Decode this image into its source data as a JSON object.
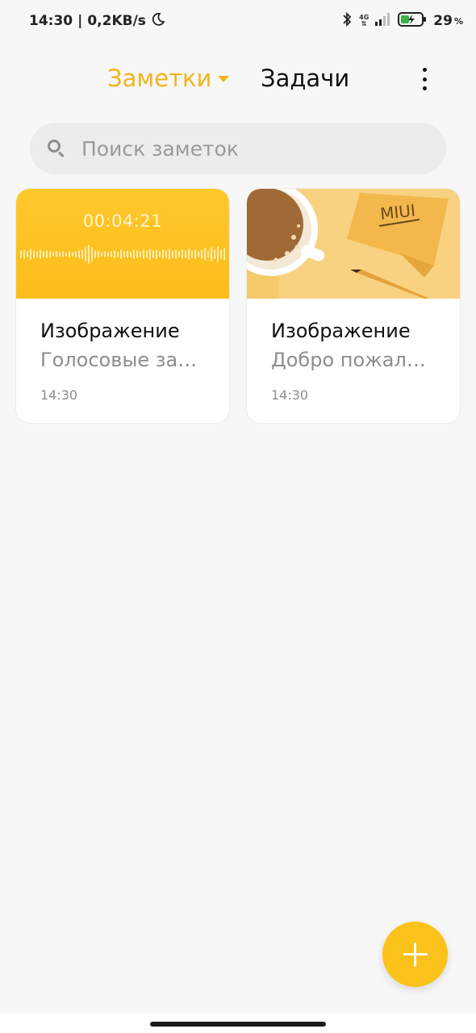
{
  "status_bar": {
    "time": "14:30",
    "separator": "|",
    "net_speed": "0,2KB/s",
    "network": "4G",
    "battery_level": "29",
    "battery_unit": "%",
    "icons": [
      "moon-icon",
      "bluetooth-icon",
      "signal-icon",
      "battery-charging-icon"
    ]
  },
  "header": {
    "tabs": [
      {
        "label": "Заметки",
        "active": true
      },
      {
        "label": "Задачи",
        "active": false
      }
    ],
    "more_icon": "more-vertical-icon"
  },
  "search": {
    "placeholder": "Поиск заметок",
    "value": ""
  },
  "notes": [
    {
      "title": "Изображение",
      "preview": "Голосовые за…",
      "time": "14:30",
      "media": {
        "type": "voice-recording",
        "duration": "00:04:21"
      }
    },
    {
      "title": "Изображение",
      "preview": "Добро пожал…",
      "time": "14:30",
      "media": {
        "type": "image",
        "caption": "MIUI"
      }
    }
  ],
  "fab": {
    "icon": "plus-icon"
  },
  "colors": {
    "accent": "#f2b41c",
    "fab": "#fbc21c",
    "background": "#f7f7f7"
  }
}
